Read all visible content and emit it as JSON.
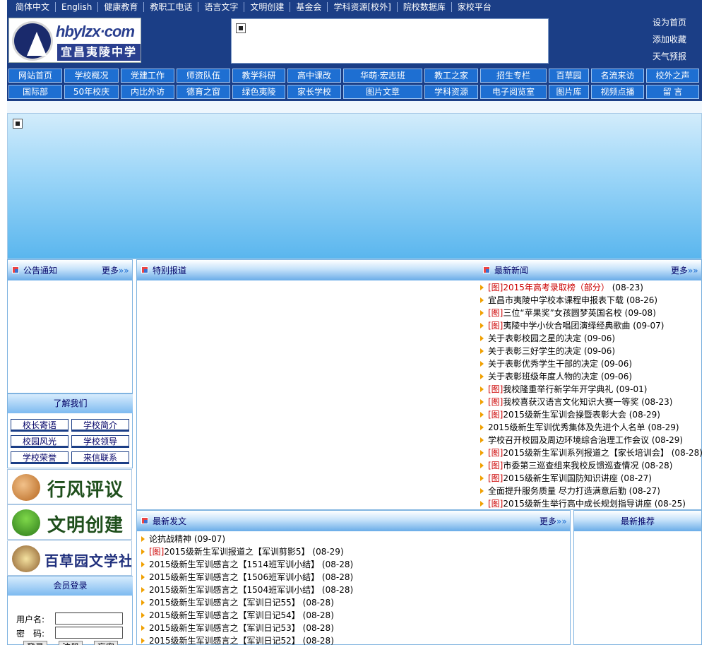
{
  "topbar": {
    "links": [
      "简体中文",
      "English",
      "健康教育",
      "教职工电话",
      "语言文字",
      "文明创建",
      "基金会",
      "学科资源[校外]",
      "院校数据库",
      "家校平台"
    ]
  },
  "header": {
    "logo_url_text": "hbylzx·com",
    "logo_school_name": "宜昌夷陵中学",
    "links": [
      "设为首页",
      "添加收藏",
      "天气预报"
    ]
  },
  "nav": {
    "row1": [
      "网站首页",
      "学校概况",
      "党建工作",
      "师资队伍",
      "教学科研",
      "高中课改",
      "华萌·宏志班",
      "教工之家",
      "招生专栏",
      "百草园",
      "名流来访",
      "校外之声"
    ],
    "row2": [
      "国际部",
      "50年校庆",
      "内比外访",
      "德育之窗",
      "绿色夷陵",
      "家长学校",
      "图片文章",
      "学科资源",
      "电子阅览室",
      "图片库",
      "视频点播",
      "留 言"
    ]
  },
  "notice": {
    "title": "公告通知",
    "more": "更多"
  },
  "special": {
    "title": "特别报道"
  },
  "latest_news": {
    "title": "最新新闻",
    "more": "更多",
    "items": [
      {
        "tag": "[图]",
        "text": "2015年高考录取榜（部分）",
        "date": "(08-23)",
        "highlight": true
      },
      {
        "tag": "",
        "text": "宜昌市夷陵中学校本课程申报表下载",
        "date": "(08-26)",
        "highlight": false
      },
      {
        "tag": "[图]",
        "text": "三位“苹果奖”女孩圆梦英国名校",
        "date": "(09-08)",
        "highlight": false
      },
      {
        "tag": "[图]",
        "text": "夷陵中学小伙合唱团演绎经典歌曲",
        "date": "(09-07)",
        "highlight": false
      },
      {
        "tag": "",
        "text": "关于表彰校园之星的决定",
        "date": "(09-06)",
        "highlight": false
      },
      {
        "tag": "",
        "text": "关于表彰三好学生的决定",
        "date": "(09-06)",
        "highlight": false
      },
      {
        "tag": "",
        "text": "关于表彰优秀学生干部的决定",
        "date": "(09-06)",
        "highlight": false
      },
      {
        "tag": "",
        "text": "关于表彰班级年度人物的决定",
        "date": "(09-06)",
        "highlight": false
      },
      {
        "tag": "[图]",
        "text": "我校隆重举行新学年开学典礼",
        "date": "(09-01)",
        "highlight": false
      },
      {
        "tag": "[图]",
        "text": "我校喜获汉语言文化知识大赛一等奖",
        "date": "(08-23)",
        "highlight": false
      },
      {
        "tag": "[图]",
        "text": "2015级新生军训会操暨表彰大会",
        "date": "(08-29)",
        "highlight": false
      },
      {
        "tag": "",
        "text": "2015级新生军训优秀集体及先进个人名单",
        "date": "(08-29)",
        "highlight": false
      },
      {
        "tag": "",
        "text": "学校召开校园及周边环境综合治理工作会议",
        "date": "(08-29)",
        "highlight": false
      },
      {
        "tag": "[图]",
        "text": "2015级新生军训系列报道之【家长培训会】",
        "date": "(08-28)",
        "highlight": false
      },
      {
        "tag": "[图]",
        "text": "市委第三巡查组来我校反馈巡查情况",
        "date": "(08-28)",
        "highlight": false
      },
      {
        "tag": "[图]",
        "text": "2015级新生军训国防知识讲座",
        "date": "(08-27)",
        "highlight": false
      },
      {
        "tag": "",
        "text": "全面提升服务质量 尽力打造满意后勤",
        "date": "(08-27)",
        "highlight": false
      },
      {
        "tag": "[图]",
        "text": "2015级新生举行高中成长规划指导讲座",
        "date": "(08-25)",
        "highlight": false
      }
    ]
  },
  "about": {
    "title": "了解我们",
    "links": [
      "校长寄语",
      "学校简介",
      "校园风光",
      "学校领导",
      "学校荣誉",
      "来信联系"
    ]
  },
  "promos": [
    "行风评议",
    "文明创建",
    "百草园文学社"
  ],
  "login": {
    "title": "会员登录",
    "username_label": "用户名:",
    "password_label": "密　码:",
    "buttons": [
      "登录",
      "注册",
      "忘密"
    ]
  },
  "latest_posts": {
    "title": "最新发文",
    "more": "更多",
    "items": [
      {
        "tag": "",
        "text": "论抗战精神",
        "date": "(09-07)"
      },
      {
        "tag": "[图]",
        "text": "2015级新生军训报道之【军训剪影5】",
        "date": "(08-29)"
      },
      {
        "tag": "",
        "text": "2015级新生军训感言之【1514班军训小结】",
        "date": "(08-28)"
      },
      {
        "tag": "",
        "text": "2015级新生军训感言之【1506班军训小结】",
        "date": "(08-28)"
      },
      {
        "tag": "",
        "text": "2015级新生军训感言之【1504班军训小结】",
        "date": "(08-28)"
      },
      {
        "tag": "",
        "text": "2015级新生军训感言之【军训日记55】",
        "date": "(08-28)"
      },
      {
        "tag": "",
        "text": "2015级新生军训感言之【军训日记54】",
        "date": "(08-28)"
      },
      {
        "tag": "",
        "text": "2015级新生军训感言之【军训日记53】",
        "date": "(08-28)"
      },
      {
        "tag": "",
        "text": "2015级新生军训感言之【军训日记52】",
        "date": "(08-28)"
      }
    ]
  },
  "recommend": {
    "title": "最新推荐"
  }
}
